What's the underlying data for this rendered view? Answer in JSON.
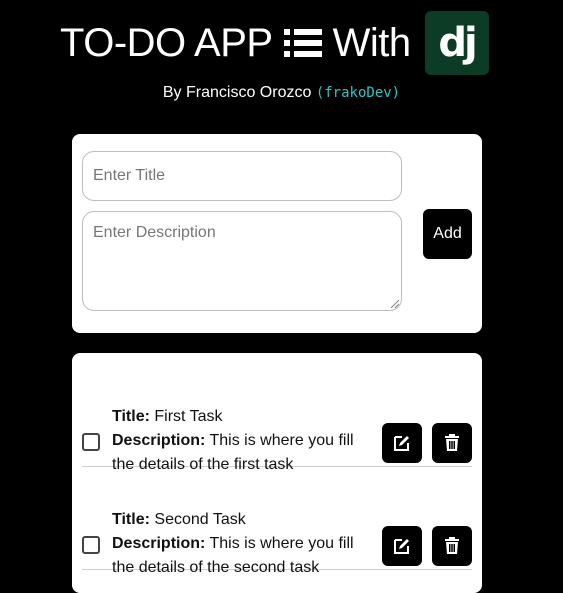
{
  "header": {
    "title": "TO-DO APP",
    "with_text": "With",
    "logo_text": "dj",
    "list_icon": "list-icon",
    "logo_icon": "django-logo"
  },
  "byline": {
    "text": "By Francisco Orozco",
    "handle": "(frakoDev)"
  },
  "form": {
    "title_placeholder": "Enter Title",
    "description_placeholder": "Enter Description",
    "add_label": "Add"
  },
  "tasks": [
    {
      "title_label": "Title:",
      "title": "First Task",
      "description_label": "Description:",
      "description": "This is where you fill the details of the first task"
    },
    {
      "title_label": "Title:",
      "title": "Second Task",
      "description_label": "Description:",
      "description": "This is where you fill the details of the second task"
    }
  ],
  "colors": {
    "background": "#000000",
    "card": "#ffffff",
    "handle": "#2ec4c7",
    "django_green": "#0c3c26"
  }
}
